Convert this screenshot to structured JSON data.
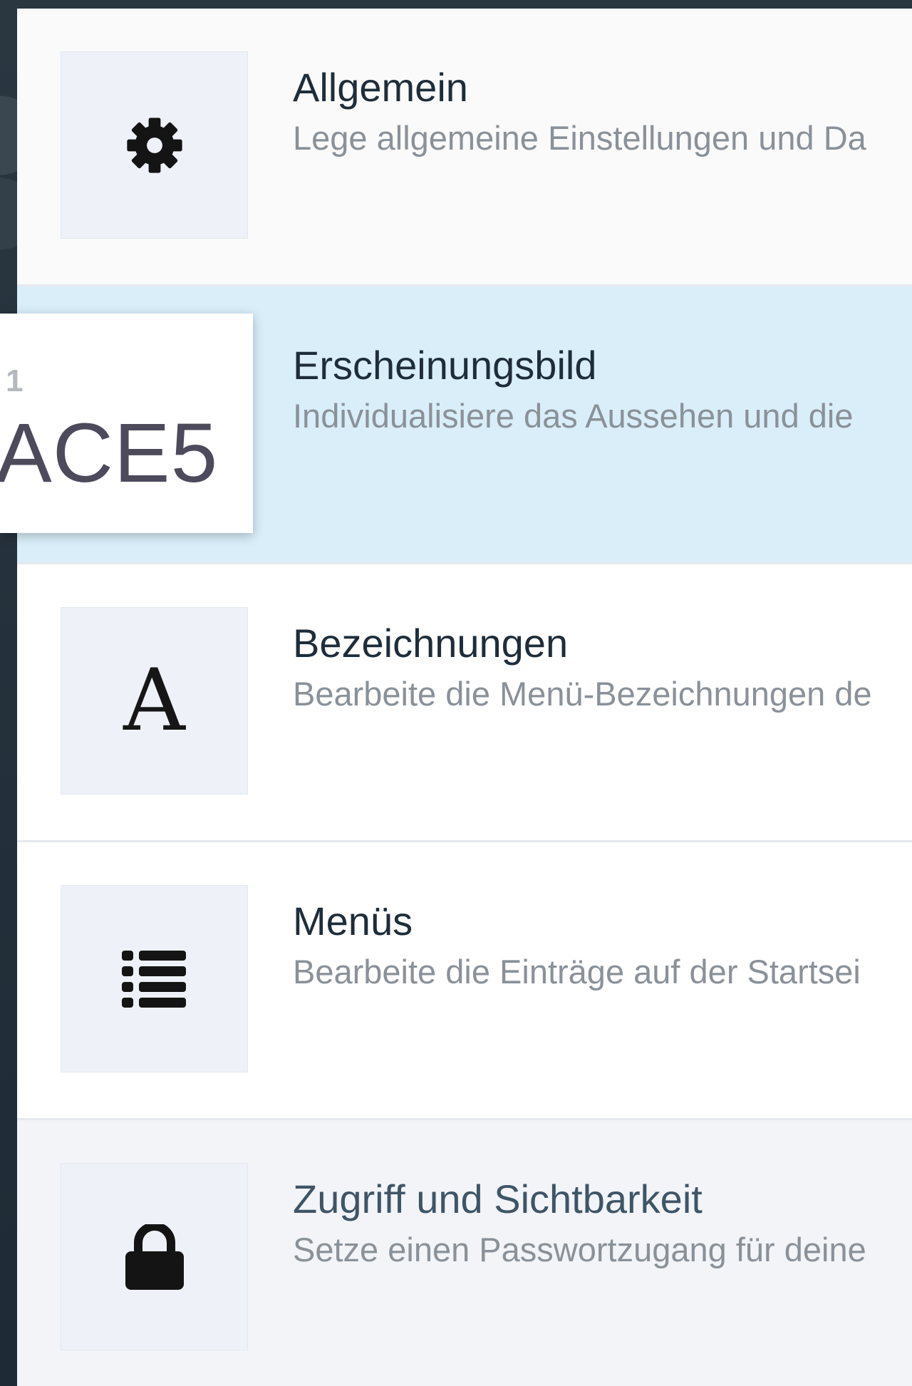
{
  "settings": {
    "items": [
      {
        "title": "Allgemein",
        "description": "Lege allgemeine Einstellungen und Da",
        "icon": "gear-icon"
      },
      {
        "title": "Erscheinungsbild",
        "description": "Individualisiere das Aussehen und die",
        "icon": "appearance-icon"
      },
      {
        "title": "Bezeichnungen",
        "description": "Bearbeite die Menü-Bezeichnungen de",
        "icon": "letter-a-icon",
        "icon_glyph": "A"
      },
      {
        "title": "Menüs",
        "description": "Bearbeite die Einträge auf der Startsei",
        "icon": "list-icon"
      },
      {
        "title": "Zugriff und Sichtbarkeit",
        "description": "Setze einen Passwortzugang für deine",
        "icon": "lock-icon"
      }
    ],
    "selected_index": 1
  },
  "overlay": {
    "small_text": "1",
    "big_text": "ACE5"
  },
  "colors": {
    "selected_row": "#d9eef9",
    "title": "#1e2d39",
    "description": "#8a9198",
    "tile": "#eef2f8"
  }
}
